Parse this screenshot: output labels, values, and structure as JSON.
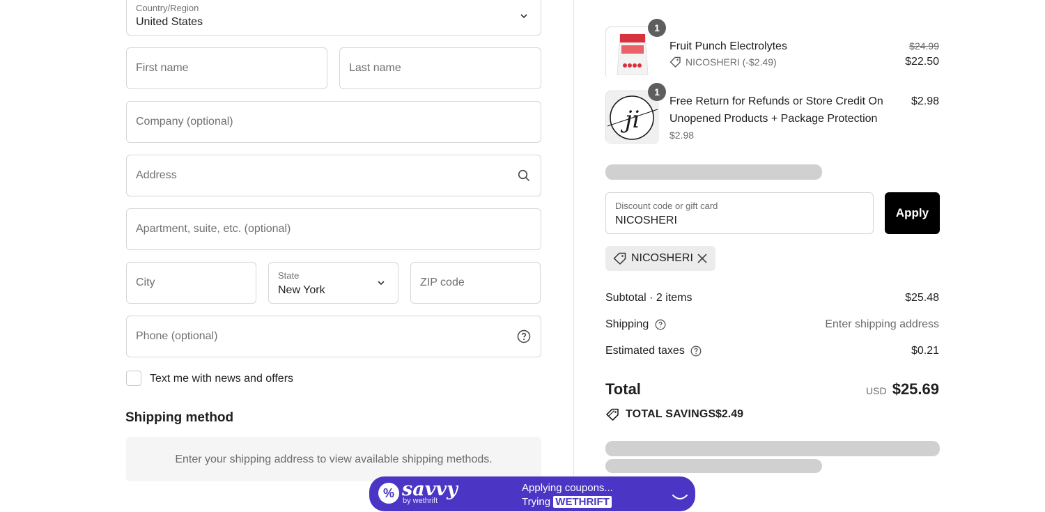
{
  "form": {
    "country": {
      "label": "Country/Region",
      "value": "United States"
    },
    "first_name": {
      "placeholder": "First name"
    },
    "last_name": {
      "placeholder": "Last name"
    },
    "company": {
      "placeholder": "Company (optional)"
    },
    "address": {
      "placeholder": "Address"
    },
    "apartment": {
      "placeholder": "Apartment, suite, etc. (optional)"
    },
    "city": {
      "placeholder": "City"
    },
    "state": {
      "label": "State",
      "value": "New York"
    },
    "zip": {
      "placeholder": "ZIP code"
    },
    "phone": {
      "placeholder": "Phone (optional)"
    },
    "sms_opt_in": {
      "label": "Text me with news and offers",
      "checked": false
    }
  },
  "shipping": {
    "title": "Shipping method",
    "message": "Enter your shipping address to view available shipping methods."
  },
  "cart": {
    "items": [
      {
        "name": "Fruit Punch Electrolytes",
        "quantity": "1",
        "discount": "NICOSHERI (-$2.49)",
        "original_price": "$24.99",
        "price": "$22.50",
        "thumb_icon": "electrolytes-pouch-image"
      },
      {
        "name_line1": "Free Return for Refunds or Store Credit On",
        "name_line2": "Unopened Products + Package Protection",
        "quantity": "1",
        "sub_price": "$2.98",
        "price": "$2.98",
        "thumb_icon": "ji-logo-image"
      }
    ]
  },
  "discount": {
    "label": "Discount code or gift card",
    "value": "NICOSHERI",
    "apply_label": "Apply",
    "applied_code": "NICOSHERI"
  },
  "summary": {
    "subtotal_label": "Subtotal · 2 items",
    "subtotal_value": "$25.48",
    "shipping_label": "Shipping",
    "shipping_value": "Enter shipping address",
    "taxes_label": "Estimated taxes",
    "taxes_value": "$0.21",
    "total_label": "Total",
    "total_currency": "USD",
    "total_value": "$25.69",
    "savings_label": "TOTAL SAVINGS",
    "savings_value": "$2.49"
  },
  "savvy": {
    "brand": "savvy",
    "by": "by wethrift",
    "line1": "Applying coupons...",
    "trying_label": "Trying",
    "trying_code": "WETHRIFT",
    "color": "#4a35c4"
  }
}
